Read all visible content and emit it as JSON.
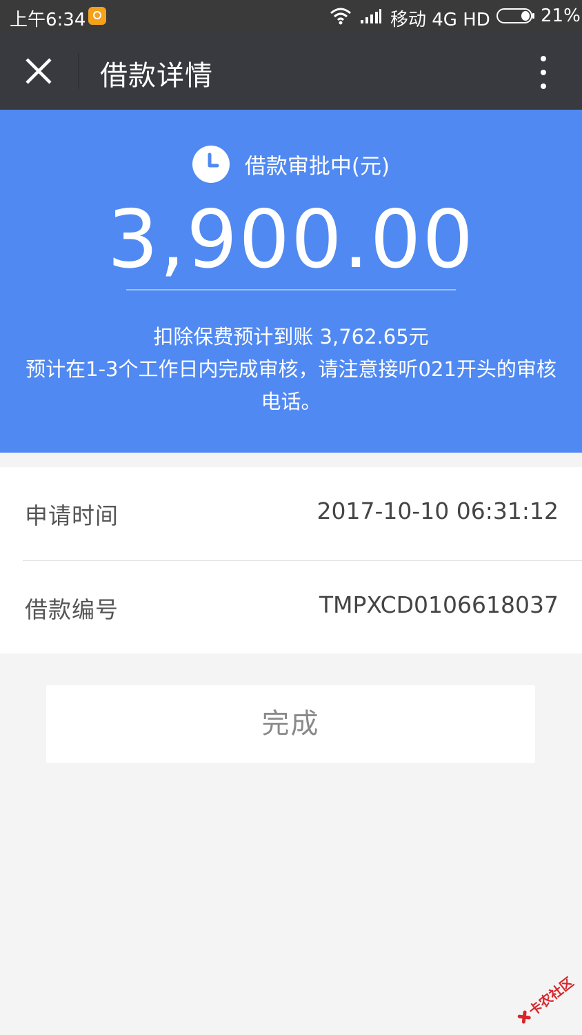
{
  "status_bar": {
    "time": "上午6:34",
    "carrier": "移动 4G HD",
    "battery_percent": "21%",
    "battery_level": 0.21,
    "app_icon_color": "#f4a11c"
  },
  "nav": {
    "title": "借款详情",
    "close_icon": "close-icon",
    "more_icon": "more-vertical-icon",
    "background": "#393a3f"
  },
  "hero": {
    "status_label": "借款审批中(元)",
    "amount": "3,900.00",
    "line1": "扣除保费预计到账 3,762.65元",
    "line2": "预计在1-3个工作日内完成审核，请注意接听021开头的审核电话。",
    "background": "#5089f2"
  },
  "details": {
    "rows": [
      {
        "label": "申请时间",
        "value": "2017-10-10 06:31:12"
      },
      {
        "label": "借款编号",
        "value": "TMPXCD0106618037"
      }
    ]
  },
  "actions": {
    "done_label": "完成"
  },
  "watermark": {
    "text": "卡农社区"
  }
}
